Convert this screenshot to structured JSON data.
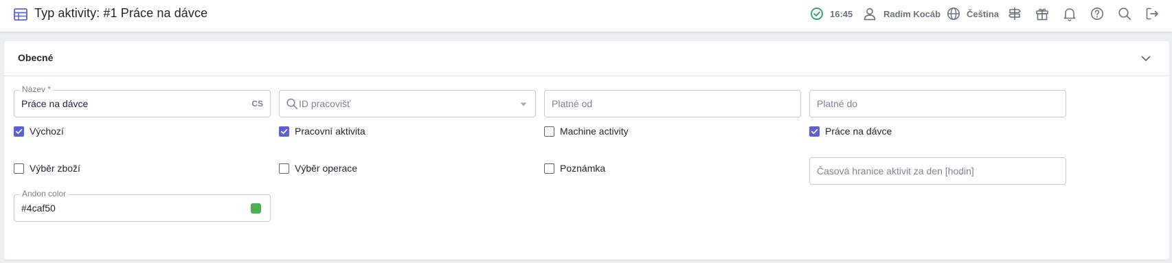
{
  "header": {
    "title": "Typ aktivity: #1 Práce na dávce",
    "title_icon": "table-icon",
    "time": "16:45",
    "user": "Radim Kocáb",
    "language": "Čeština",
    "status_color": "#22a86b",
    "icon_color": "#6d7182",
    "accent": "#5b63d3"
  },
  "card": {
    "title": "Obecné",
    "fields": {
      "name": {
        "label": "Název",
        "required_mark": "*",
        "value": "Práce na dávce",
        "suffix": "CS"
      },
      "workplace_id": {
        "placeholder": "ID pracovišť"
      },
      "valid_from": {
        "placeholder": "Platné od"
      },
      "valid_to": {
        "placeholder": "Platné do"
      },
      "time_limit": {
        "placeholder": "Časová hranice aktivit za den [hodin]"
      },
      "andon_color": {
        "label": "Andon color",
        "value": "#4caf50",
        "swatch": "#4caf50"
      }
    },
    "checkboxes": {
      "default": {
        "label": "Výchozí",
        "checked": true
      },
      "work_activity": {
        "label": "Pracovní aktivita",
        "checked": true
      },
      "machine_activity": {
        "label": "Machine activity",
        "checked": false
      },
      "batch_work": {
        "label": "Práce na dávce",
        "checked": true
      },
      "goods_selection": {
        "label": "Výběr zboží",
        "checked": false
      },
      "operation_selection": {
        "label": "Výběr operace",
        "checked": false
      },
      "note": {
        "label": "Poznámka",
        "checked": false
      }
    }
  }
}
